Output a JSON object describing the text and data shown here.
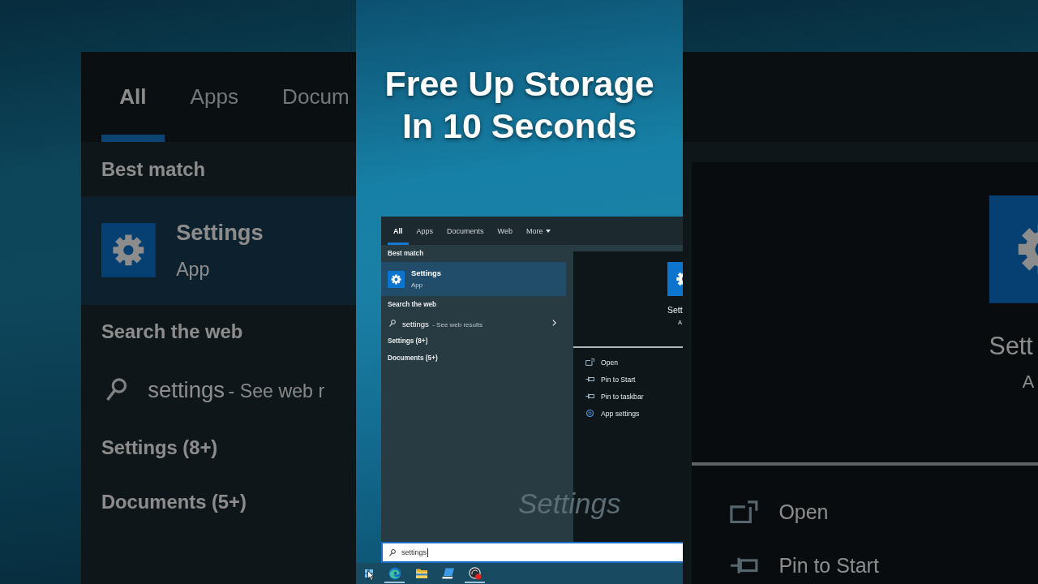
{
  "backdrop_left": {
    "tabs": [
      {
        "label": "All",
        "selected": true
      },
      {
        "label": "Apps",
        "selected": false
      },
      {
        "label": "Docum",
        "selected": false
      }
    ],
    "sections": [
      {
        "heading": "Best match",
        "items": [
          {
            "kind": "app",
            "title": "Settings",
            "subtitle": "App",
            "selected": true
          }
        ]
      },
      {
        "heading": "Search the web",
        "items": [
          {
            "kind": "web",
            "query": "settings",
            "hint": "- See web r",
            "selected": false
          }
        ]
      },
      {
        "heading": "Settings (8+)"
      },
      {
        "heading": "Documents (5+)"
      }
    ]
  },
  "caption": {
    "lines": [
      "Free Up Storage",
      "In 10 Seconds"
    ]
  },
  "start_menu": {
    "tabs": [
      {
        "label": "All",
        "selected": true,
        "has_menu": false
      },
      {
        "label": "Apps",
        "selected": false,
        "has_menu": false
      },
      {
        "label": "Documents",
        "selected": false,
        "has_menu": false
      },
      {
        "label": "Web",
        "selected": false,
        "has_menu": false
      },
      {
        "label": "More",
        "selected": false,
        "has_menu": true
      }
    ],
    "sections": [
      {
        "heading": "Best match",
        "items": [
          {
            "kind": "app",
            "title": "Settings",
            "subtitle": "App",
            "selected": true
          }
        ]
      },
      {
        "heading": "Search the web",
        "items": [
          {
            "kind": "web",
            "query": "settings",
            "hint": "- See web results",
            "selected": false
          }
        ]
      },
      {
        "heading": "Settings (8+)"
      },
      {
        "heading": "Documents (5+)"
      }
    ],
    "preview": {
      "title": "Sett",
      "subtitle": "A"
    },
    "actions": [
      {
        "kind": "open",
        "label": "Open"
      },
      {
        "kind": "pin",
        "label": "Pin to Start"
      },
      {
        "kind": "pin",
        "label": "Pin to taskbar"
      },
      {
        "kind": "settings",
        "label": "App settings"
      }
    ],
    "overlay_text": "Settings"
  },
  "search_box": {
    "value": "settings",
    "focused": true
  },
  "taskbar": {
    "apps": [
      {
        "kind": "swirl",
        "running": true
      },
      {
        "kind": "folder",
        "running": false
      },
      {
        "kind": "laptop",
        "running": false
      },
      {
        "kind": "disc",
        "running": true
      }
    ]
  },
  "backdrop_right": {
    "preview": {
      "title": "Sett",
      "subtitle": "A"
    },
    "actions": [
      {
        "kind": "open",
        "label": "Open"
      },
      {
        "kind": "pin",
        "label": "Pin to Start"
      }
    ]
  }
}
